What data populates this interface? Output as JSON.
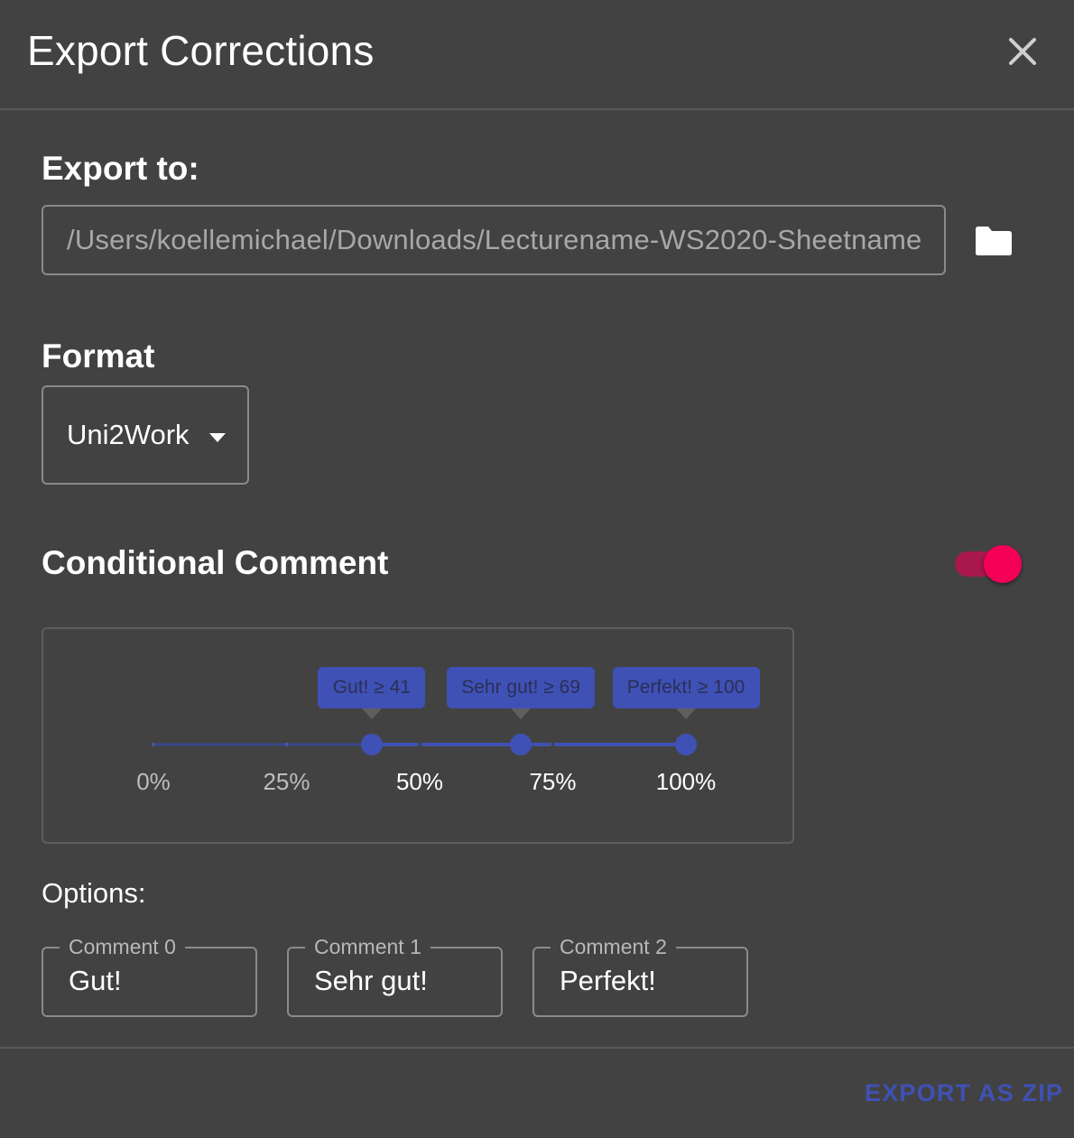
{
  "dialog": {
    "title": "Export Corrections"
  },
  "export_to": {
    "label": "Export to:",
    "path": "/Users/koellemichael/Downloads/Lecturename-WS2020-Sheetname"
  },
  "format": {
    "label": "Format",
    "selected": "Uni2Work"
  },
  "conditional_comment": {
    "label": "Conditional Comment",
    "enabled": true,
    "toggle_color": "#f50057",
    "slider": {
      "accent": "#3f51b5",
      "ticks": [
        {
          "value": 0,
          "label": "0%"
        },
        {
          "value": 25,
          "label": "25%"
        },
        {
          "value": 50,
          "label": "50%"
        },
        {
          "value": 75,
          "label": "75%"
        },
        {
          "value": 100,
          "label": "100%"
        }
      ],
      "thresholds": [
        {
          "value": 41,
          "label": "Gut! ≥ 41"
        },
        {
          "value": 69,
          "label": "Sehr gut! ≥ 69"
        },
        {
          "value": 100,
          "label": "Perfekt! ≥ 100"
        }
      ]
    }
  },
  "options": {
    "label": "Options:",
    "comments": [
      {
        "legend": "Comment 0",
        "value": "Gut!"
      },
      {
        "legend": "Comment 1",
        "value": "Sehr gut!"
      },
      {
        "legend": "Comment 2",
        "value": "Perfekt!"
      }
    ]
  },
  "actions": {
    "export_label": "EXPORT AS ZIP"
  },
  "icons": {
    "close": "close-icon",
    "folder": "folder-icon",
    "dropdown": "chevron-down-icon"
  }
}
